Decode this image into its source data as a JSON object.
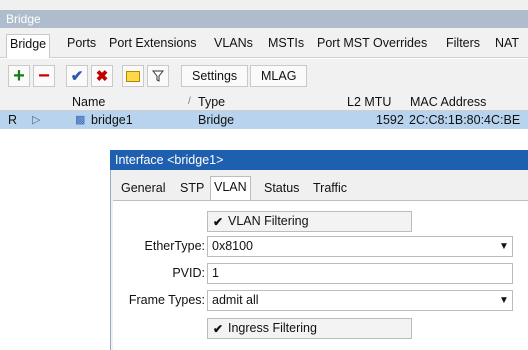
{
  "window": {
    "title": "Bridge"
  },
  "tabs": [
    "Bridge",
    "Ports",
    "Port Extensions",
    "VLANs",
    "MSTIs",
    "Port MST Overrides",
    "Filters",
    "NAT"
  ],
  "toolbar": {
    "settings_label": "Settings",
    "mlag_label": "MLAG"
  },
  "table": {
    "headers": {
      "name": "Name",
      "type": "Type",
      "l2mtu": "L2 MTU",
      "mac": "MAC Address"
    },
    "row": {
      "flag": "R",
      "name": "bridge1",
      "type": "Bridge",
      "l2mtu": "1592",
      "mac": "2C:C8:1B:80:4C:BE"
    }
  },
  "dialog": {
    "title": "Interface <bridge1>",
    "tabs": [
      "General",
      "STP",
      "VLAN",
      "Status",
      "Traffic"
    ],
    "vlan_filtering_label": "VLAN Filtering",
    "ethertype_label": "EtherType:",
    "ethertype_value": "0x8100",
    "pvid_label": "PVID:",
    "pvid_value": "1",
    "frame_types_label": "Frame Types:",
    "frame_types_value": "admit all",
    "ingress_filtering_label": "Ingress Filtering"
  },
  "colors": {
    "title_bar": "#aebccb",
    "selected_row": "#b7d3ee",
    "dialog_title": "#1f5fb0",
    "add_icon": "#1a7a1a",
    "remove_icon": "#c00000"
  }
}
